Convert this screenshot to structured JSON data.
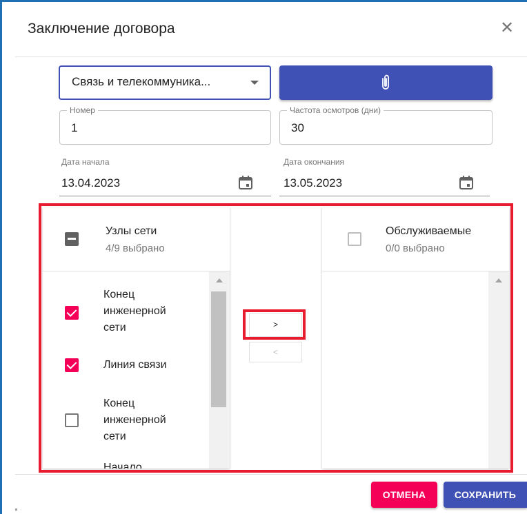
{
  "dialog": {
    "title": "Заключение договора"
  },
  "service_select": {
    "value": "Связь и телекоммуника..."
  },
  "fields": {
    "number_label": "Номер",
    "number_value": "1",
    "frequency_label": "Частота осмотров (дни)",
    "frequency_value": "30",
    "start_label": "Дата начала",
    "start_value": "13.04.2023",
    "end_label": "Дата окончания",
    "end_value": "13.05.2023"
  },
  "left_list": {
    "title": "Узлы сети",
    "subtitle": "4/9 выбрано",
    "items": [
      {
        "label": "Конец инженерной сети",
        "checked": true
      },
      {
        "label": "Линия связи",
        "checked": true
      },
      {
        "label": "Конец инженерной сети",
        "checked": false
      },
      {
        "label": "Начало",
        "checked": false
      }
    ]
  },
  "right_list": {
    "title": "Обслуживаемые",
    "subtitle": "0/0 выбрано"
  },
  "transfer": {
    "move_right": ">",
    "move_left": "<"
  },
  "actions": {
    "cancel": "ОТМЕНА",
    "save": "СОХРАНИТЬ"
  },
  "colors": {
    "primary": "#3f51b5",
    "secondary": "#f50057",
    "highlight": "#e81c2e",
    "window_border": "#1f6fb2"
  }
}
